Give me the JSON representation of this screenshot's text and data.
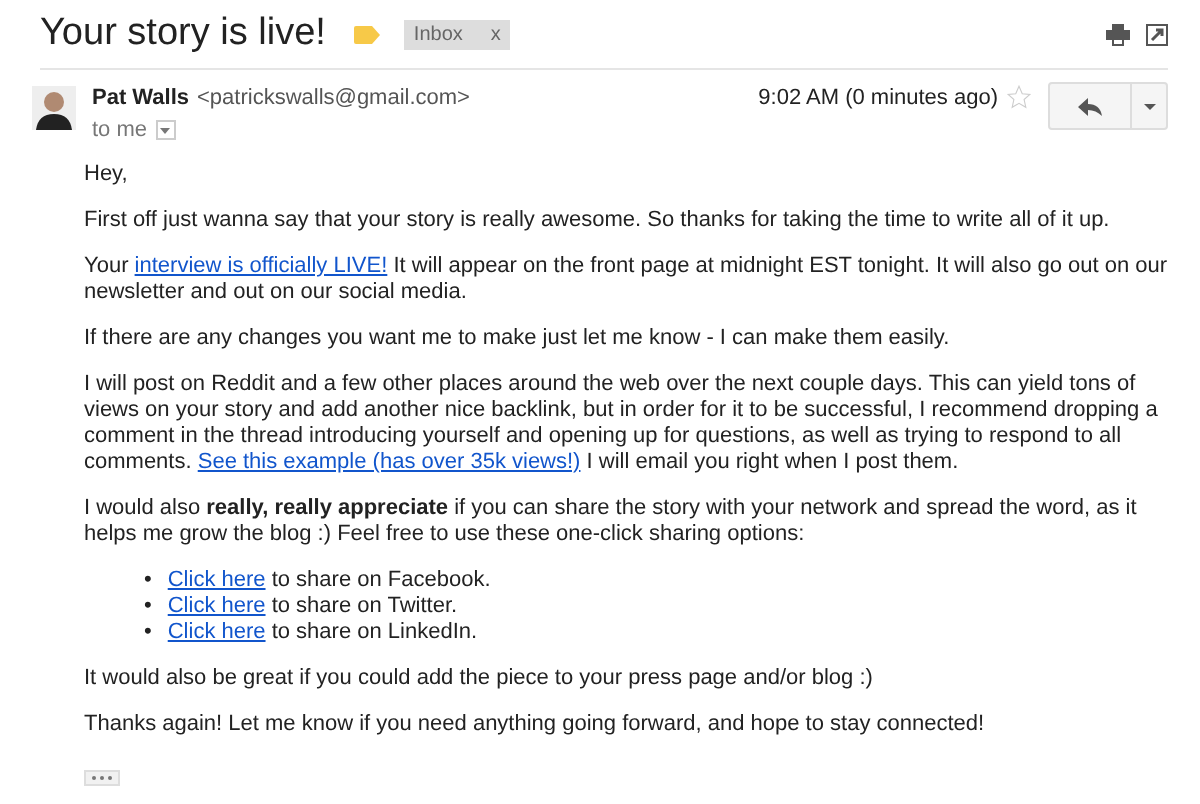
{
  "subject": "Your story is live!",
  "label_tag": {
    "text": "Inbox",
    "close": "x"
  },
  "sender": {
    "name": "Pat Walls",
    "email": "<patrickswalls@gmail.com>",
    "recipient": "to me",
    "time": "9:02 AM (0 minutes ago)",
    "starred": false
  },
  "body": [
    {
      "kind": "paragraph",
      "segments": [
        {
          "kind": "text",
          "text": "Hey,"
        }
      ]
    },
    {
      "kind": "paragraph",
      "segments": [
        {
          "kind": "text",
          "text": "First off just wanna say that your story is really awesome. So thanks for taking the time to write all of it up."
        }
      ]
    },
    {
      "kind": "paragraph",
      "segments": [
        {
          "kind": "text",
          "text": "Your "
        },
        {
          "kind": "link",
          "text": "interview is officially LIVE!"
        },
        {
          "kind": "text",
          "text": " It will appear on the front page at midnight EST tonight. It will also go out on our newsletter and out on our social media."
        }
      ]
    },
    {
      "kind": "paragraph",
      "segments": [
        {
          "kind": "text",
          "text": "If there are any changes you want me to make just let me know - I can make them easily."
        }
      ]
    },
    {
      "kind": "paragraph",
      "segments": [
        {
          "kind": "text",
          "text": "I will post on Reddit and a few other places around the web over the next couple days. This can yield tons of views on your story and add another nice backlink, but in order for it to be successful, I recommend dropping a comment in the thread introducing yourself and opening up for questions, as well as trying to respond to all comments. "
        },
        {
          "kind": "link",
          "text": "See this example (has over 35k views!)"
        },
        {
          "kind": "text",
          "text": " I will email you right when I post them."
        }
      ]
    },
    {
      "kind": "paragraph",
      "segments": [
        {
          "kind": "text",
          "text": "I would also **really, really appreciate** if you can share the story with your network and spread the word, as it helps me grow the blog :) Feel free to use these one-click sharing options:"
        }
      ]
    },
    {
      "kind": "list",
      "items": [
        {
          "marker": "•",
          "segments": [
            {
              "kind": "link",
              "text": "Click here"
            },
            {
              "kind": "text",
              "text": " to share on Facebook."
            }
          ]
        },
        {
          "marker": "•",
          "segments": [
            {
              "kind": "link",
              "text": "Click here"
            },
            {
              "kind": "text",
              "text": " to share on Twitter."
            }
          ]
        },
        {
          "marker": "•",
          "segments": [
            {
              "kind": "link",
              "text": "Click here"
            },
            {
              "kind": "text",
              "text": " to share on LinkedIn."
            }
          ]
        }
      ]
    },
    {
      "kind": "paragraph",
      "segments": [
        {
          "kind": "text",
          "text": "It would also be great if you could add the piece to your press page and/or blog :)"
        }
      ]
    },
    {
      "kind": "paragraph",
      "segments": [
        {
          "kind": "text",
          "text": "Thanks again! Let me know if you need anything going forward, and hope to stay connected!"
        }
      ]
    }
  ]
}
